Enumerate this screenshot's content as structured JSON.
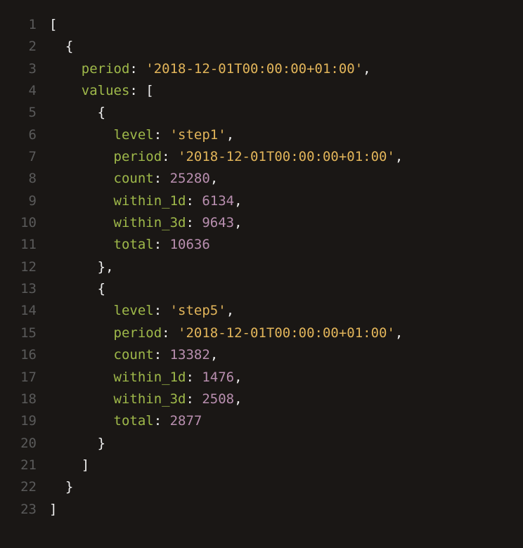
{
  "lines": [
    {
      "n": "1",
      "tokens": [
        {
          "t": "punct",
          "v": "["
        }
      ]
    },
    {
      "n": "2",
      "tokens": [
        {
          "t": "ws",
          "v": "  "
        },
        {
          "t": "punct",
          "v": "{"
        }
      ]
    },
    {
      "n": "3",
      "tokens": [
        {
          "t": "ws",
          "v": "    "
        },
        {
          "t": "key",
          "v": "period"
        },
        {
          "t": "punct",
          "v": ": "
        },
        {
          "t": "string",
          "v": "'2018-12-01T00:00:00+01:00'"
        },
        {
          "t": "punct",
          "v": ","
        }
      ]
    },
    {
      "n": "4",
      "tokens": [
        {
          "t": "ws",
          "v": "    "
        },
        {
          "t": "key",
          "v": "values"
        },
        {
          "t": "punct",
          "v": ": ["
        }
      ]
    },
    {
      "n": "5",
      "tokens": [
        {
          "t": "ws",
          "v": "      "
        },
        {
          "t": "punct",
          "v": "{"
        }
      ]
    },
    {
      "n": "6",
      "tokens": [
        {
          "t": "ws",
          "v": "        "
        },
        {
          "t": "key",
          "v": "level"
        },
        {
          "t": "punct",
          "v": ": "
        },
        {
          "t": "string",
          "v": "'step1'"
        },
        {
          "t": "punct",
          "v": ","
        }
      ]
    },
    {
      "n": "7",
      "tokens": [
        {
          "t": "ws",
          "v": "        "
        },
        {
          "t": "key",
          "v": "period"
        },
        {
          "t": "punct",
          "v": ": "
        },
        {
          "t": "string",
          "v": "'2018-12-01T00:00:00+01:00'"
        },
        {
          "t": "punct",
          "v": ","
        }
      ]
    },
    {
      "n": "8",
      "tokens": [
        {
          "t": "ws",
          "v": "        "
        },
        {
          "t": "key",
          "v": "count"
        },
        {
          "t": "punct",
          "v": ": "
        },
        {
          "t": "number",
          "v": "25280"
        },
        {
          "t": "punct",
          "v": ","
        }
      ]
    },
    {
      "n": "9",
      "tokens": [
        {
          "t": "ws",
          "v": "        "
        },
        {
          "t": "key",
          "v": "within_1d"
        },
        {
          "t": "punct",
          "v": ": "
        },
        {
          "t": "number",
          "v": "6134"
        },
        {
          "t": "punct",
          "v": ","
        }
      ]
    },
    {
      "n": "10",
      "tokens": [
        {
          "t": "ws",
          "v": "        "
        },
        {
          "t": "key",
          "v": "within_3d"
        },
        {
          "t": "punct",
          "v": ": "
        },
        {
          "t": "number",
          "v": "9643"
        },
        {
          "t": "punct",
          "v": ","
        }
      ]
    },
    {
      "n": "11",
      "tokens": [
        {
          "t": "ws",
          "v": "        "
        },
        {
          "t": "key",
          "v": "total"
        },
        {
          "t": "punct",
          "v": ": "
        },
        {
          "t": "number",
          "v": "10636"
        }
      ]
    },
    {
      "n": "12",
      "tokens": [
        {
          "t": "ws",
          "v": "      "
        },
        {
          "t": "punct",
          "v": "},"
        }
      ]
    },
    {
      "n": "13",
      "tokens": [
        {
          "t": "ws",
          "v": "      "
        },
        {
          "t": "punct",
          "v": "{"
        }
      ]
    },
    {
      "n": "14",
      "tokens": [
        {
          "t": "ws",
          "v": "        "
        },
        {
          "t": "key",
          "v": "level"
        },
        {
          "t": "punct",
          "v": ": "
        },
        {
          "t": "string",
          "v": "'step5'"
        },
        {
          "t": "punct",
          "v": ","
        }
      ]
    },
    {
      "n": "15",
      "tokens": [
        {
          "t": "ws",
          "v": "        "
        },
        {
          "t": "key",
          "v": "period"
        },
        {
          "t": "punct",
          "v": ": "
        },
        {
          "t": "string",
          "v": "'2018-12-01T00:00:00+01:00'"
        },
        {
          "t": "punct",
          "v": ","
        }
      ]
    },
    {
      "n": "16",
      "tokens": [
        {
          "t": "ws",
          "v": "        "
        },
        {
          "t": "key",
          "v": "count"
        },
        {
          "t": "punct",
          "v": ": "
        },
        {
          "t": "number",
          "v": "13382"
        },
        {
          "t": "punct",
          "v": ","
        }
      ]
    },
    {
      "n": "17",
      "tokens": [
        {
          "t": "ws",
          "v": "        "
        },
        {
          "t": "key",
          "v": "within_1d"
        },
        {
          "t": "punct",
          "v": ": "
        },
        {
          "t": "number",
          "v": "1476"
        },
        {
          "t": "punct",
          "v": ","
        }
      ]
    },
    {
      "n": "18",
      "tokens": [
        {
          "t": "ws",
          "v": "        "
        },
        {
          "t": "key",
          "v": "within_3d"
        },
        {
          "t": "punct",
          "v": ": "
        },
        {
          "t": "number",
          "v": "2508"
        },
        {
          "t": "punct",
          "v": ","
        }
      ]
    },
    {
      "n": "19",
      "tokens": [
        {
          "t": "ws",
          "v": "        "
        },
        {
          "t": "key",
          "v": "total"
        },
        {
          "t": "punct",
          "v": ": "
        },
        {
          "t": "number",
          "v": "2877"
        }
      ]
    },
    {
      "n": "20",
      "tokens": [
        {
          "t": "ws",
          "v": "      "
        },
        {
          "t": "punct",
          "v": "}"
        }
      ]
    },
    {
      "n": "21",
      "tokens": [
        {
          "t": "ws",
          "v": "    "
        },
        {
          "t": "punct",
          "v": "]"
        }
      ]
    },
    {
      "n": "22",
      "tokens": [
        {
          "t": "ws",
          "v": "  "
        },
        {
          "t": "punct",
          "v": "}"
        }
      ]
    },
    {
      "n": "23",
      "tokens": [
        {
          "t": "punct",
          "v": "]"
        }
      ]
    }
  ]
}
